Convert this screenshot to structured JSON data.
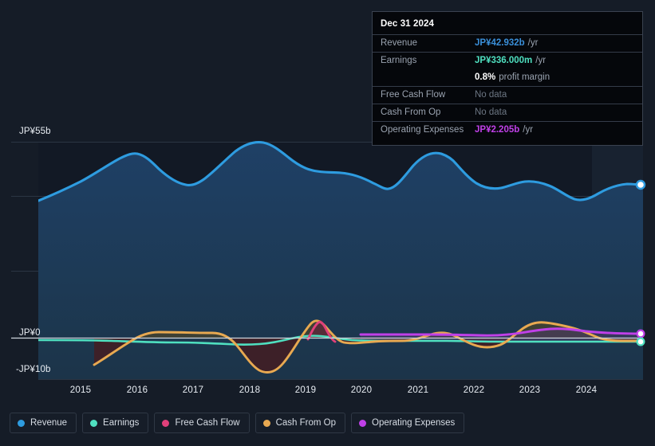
{
  "theme": {
    "background": "#151c27",
    "plot_background": "#121925",
    "grid_color": "#2b3543",
    "zero_line_color": "#cfd6de",
    "forecast_band": "#18212e",
    "text_primary": "#e8edf3",
    "text_muted": "#9aa3b0"
  },
  "tooltip": {
    "date": "Dec 31 2024",
    "rows": [
      {
        "label": "Revenue",
        "value": "JP¥42.932b",
        "suffix": "/yr",
        "color": "#3a8fd9",
        "nodata": false
      },
      {
        "label": "Earnings",
        "value": "JP¥336.000m",
        "suffix": "/yr",
        "color": "#4fe0c0",
        "nodata": false
      },
      {
        "label": "",
        "value": "0.8%",
        "suffix": "profit margin",
        "color": "#ffffff",
        "nodata": false
      },
      {
        "label": "Free Cash Flow",
        "value": "No data",
        "suffix": "",
        "color": "#6c7683",
        "nodata": true
      },
      {
        "label": "Cash From Op",
        "value": "No data",
        "suffix": "",
        "color": "#6c7683",
        "nodata": true
      },
      {
        "label": "Operating Expenses",
        "value": "JP¥2.205b",
        "suffix": "/yr",
        "color": "#c040e8",
        "nodata": false
      }
    ]
  },
  "legend": {
    "items": [
      {
        "label": "Revenue",
        "color": "#2e9ce0"
      },
      {
        "label": "Earnings",
        "color": "#4fe0c0"
      },
      {
        "label": "Free Cash Flow",
        "color": "#e0407a"
      },
      {
        "label": "Cash From Op",
        "color": "#e8a951"
      },
      {
        "label": "Operating Expenses",
        "color": "#c040e8"
      }
    ]
  },
  "chart_data": {
    "type": "area",
    "title": "",
    "xlabel": "",
    "ylabel": "",
    "currency": "JP¥",
    "grid": true,
    "legend_position": "bottom",
    "y_axis": {
      "labels": [
        "JP¥55b",
        "JP¥0",
        "-JP¥10b"
      ],
      "values": [
        55,
        0,
        -10
      ],
      "ylim": [
        -10,
        55
      ],
      "unit": "billion JPY",
      "gridlines": [
        55,
        41,
        20,
        0
      ]
    },
    "x_axis": {
      "tick_labels": [
        "2015",
        "2016",
        "2017",
        "2018",
        "2019",
        "2020",
        "2021",
        "2022",
        "2023",
        "2024"
      ],
      "xlim": [
        2014.25,
        2025.0
      ]
    },
    "forecast_start": 2024.1,
    "series": [
      {
        "name": "Revenue",
        "color": "#2e9ce0",
        "fill": "#1d3a56",
        "x": [
          2014.3,
          2014.8,
          2015.3,
          2015.8,
          2016.0,
          2016.3,
          2016.6,
          2017.0,
          2017.4,
          2017.8,
          2018.1,
          2018.5,
          2018.8,
          2019.1,
          2019.4,
          2019.8,
          2020.1,
          2020.5,
          2020.8,
          2021.1,
          2021.4,
          2021.8,
          2022.1,
          2022.5,
          2022.9,
          2023.2,
          2023.5,
          2023.9,
          2024.2,
          2024.6,
          2024.95
        ],
        "values": [
          38.5,
          42.5,
          46.0,
          50.0,
          51.6,
          51.3,
          49.4,
          44.5,
          42.8,
          45.0,
          50.0,
          53.5,
          54.8,
          53.5,
          49.0,
          46.8,
          46.5,
          41.8,
          47.0,
          49.8,
          51.8,
          50.4,
          46.0,
          44.2,
          43.3,
          43.9,
          41.3,
          38.9,
          41.0,
          41.6,
          42.932
        ]
      },
      {
        "name": "Earnings",
        "color": "#4fe0c0",
        "x": [
          2014.3,
          2015.0,
          2015.6,
          2016.2,
          2016.8,
          2017.4,
          2018.0,
          2018.6,
          2019.1,
          2019.6,
          2020.2,
          2020.8,
          2021.4,
          2022.0,
          2022.6,
          2023.2,
          2023.8,
          2024.4,
          2024.95
        ],
        "values": [
          -0.7,
          -0.7,
          -0.6,
          -0.9,
          -0.9,
          -1.2,
          -1.0,
          -0.6,
          0.1,
          0.5,
          0.1,
          -0.1,
          -0.2,
          -0.4,
          -0.3,
          -0.5,
          -0.5,
          -0.2,
          0.336
        ]
      },
      {
        "name": "Free Cash Flow",
        "color": "#e0407a",
        "x": [
          2018.9,
          2019.1,
          2019.35,
          2019.6
        ],
        "values": [
          -0.5,
          4.5,
          0.5,
          -0.9
        ]
      },
      {
        "name": "Cash From Op",
        "color": "#e8a951",
        "x": [
          2014.95,
          2015.3,
          2015.8,
          2016.2,
          2016.8,
          2017.3,
          2017.7,
          2018.0,
          2018.35,
          2018.7,
          2019.05,
          2019.35,
          2019.7,
          2020.1,
          2020.6,
          2021.0,
          2021.5,
          2021.9,
          2022.3,
          2022.7,
          2023.0,
          2023.4,
          2023.8,
          2024.2,
          2024.6,
          2024.95
        ],
        "values": [
          -7.7,
          -5.5,
          -1.8,
          1.3,
          1.4,
          1.35,
          0.0,
          -4.0,
          -9.5,
          -6.0,
          4.7,
          0.6,
          -2.2,
          -2.2,
          -2.1,
          0.9,
          -0.3,
          -1.5,
          -2.6,
          1.5,
          3.6,
          3.6,
          2.2,
          -1.1,
          -1.4,
          -1.3
        ]
      },
      {
        "name": "Operating Expenses",
        "color": "#c040e8",
        "x": [
          2020.05,
          2021.0,
          2021.8,
          2022.4,
          2022.9,
          2023.3,
          2023.7,
          2024.2,
          2024.6,
          2024.95
        ],
        "values": [
          0.95,
          0.95,
          0.95,
          0.9,
          0.85,
          1.6,
          1.75,
          1.3,
          1.5,
          2.205
        ]
      }
    ],
    "endpoints": [
      {
        "name": "Revenue",
        "color": "#2e9ce0",
        "value": 42.932
      },
      {
        "name": "Operating Expenses",
        "color": "#c040e8",
        "value": 2.205
      },
      {
        "name": "Earnings",
        "color": "#4fe0c0",
        "value": 0.336
      }
    ]
  }
}
